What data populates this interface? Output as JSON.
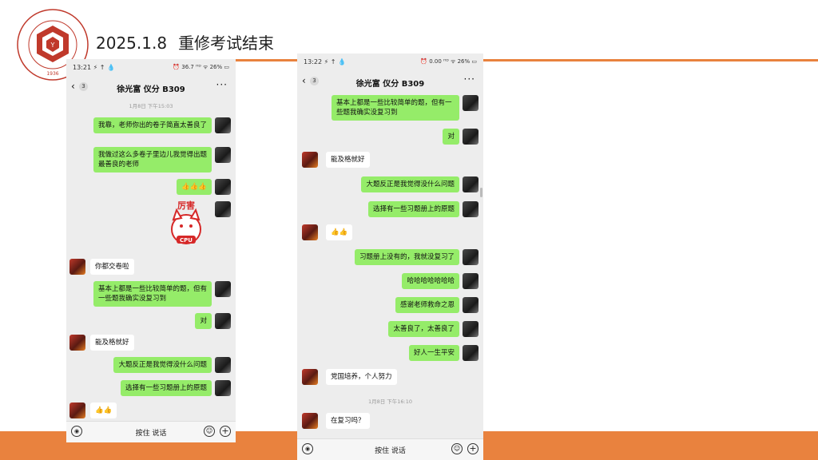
{
  "slide": {
    "date": "2025.1.8",
    "heading": "重修考试结束",
    "logo": {
      "text_top": "中国药科大学",
      "text_bottom": "CHINA PHARMACEUTICAL UNIV",
      "year": "1936"
    },
    "colors": {
      "accent": "#e9823e",
      "chat_bg": "#ededed",
      "my_bubble": "#95ec69",
      "their_bubble": "#ffffff"
    }
  },
  "phone1": {
    "status": {
      "time": "13:21 ⚡ ↑ 💧",
      "right": "⏰ 36.7 ᴴᴰ ᯤ 26% ▭"
    },
    "nav": {
      "back": "‹",
      "unread": "3",
      "name": "徐光富 仪分 B309",
      "more": "···"
    },
    "timestamp": "1月8日 下午15:03",
    "messages": [
      {
        "text": "我靠，老师你出的卷子简直太善良了"
      },
      {
        "text": "我做过这么多卷子里边儿我觉得出题最善良的老师"
      },
      {
        "text": "👍👍👍"
      },
      {
        "sticker_text": "厉害",
        "sticker_sub": "CPU"
      },
      {
        "text": "你都交卷啦"
      },
      {
        "text": "基本上都是一些比较简单的题，但有一些题我确实没复习到"
      },
      {
        "text": "对"
      },
      {
        "text": "能及格就好"
      },
      {
        "text": "大题反正是我觉得没什么问题"
      },
      {
        "text": "选择有一些习题册上的原题"
      },
      {
        "text": "👍👍"
      }
    ],
    "input": {
      "voice_icon": "◉",
      "press_label": "按住 说话",
      "emoji_icon": "☺",
      "plus_icon": "+"
    }
  },
  "phone2": {
    "status": {
      "time": "13:22 ⚡ ↑ 💧",
      "right": "⏰ 0.00 ᴴᴰ ᯤ 26% ▭"
    },
    "nav": {
      "back": "‹",
      "unread": "3",
      "name": "徐光富 仪分 B309",
      "more": "···"
    },
    "timestamp": "1月8日 下午16:10",
    "messages": [
      {
        "text": "基本上都是一些比较简单的题，但有一些题我确实没复习到"
      },
      {
        "text": "对"
      },
      {
        "text": "能及格就好"
      },
      {
        "text": "大题反正是我觉得没什么问题"
      },
      {
        "text": "选择有一些习题册上的原题"
      },
      {
        "text": "👍👍"
      },
      {
        "text": "习题册上没有的，我就没复习了"
      },
      {
        "text": "哈哈哈哈哈哈哈"
      },
      {
        "text": "感谢老师救命之恩"
      },
      {
        "text": "太善良了，太善良了"
      },
      {
        "text": "好人一生平安"
      },
      {
        "text": "党国培养，个人努力"
      },
      {
        "text": "在复习吗？"
      }
    ],
    "input": {
      "voice_icon": "◉",
      "press_label": "按住 说话",
      "emoji_icon": "☺",
      "plus_icon": "+"
    }
  }
}
